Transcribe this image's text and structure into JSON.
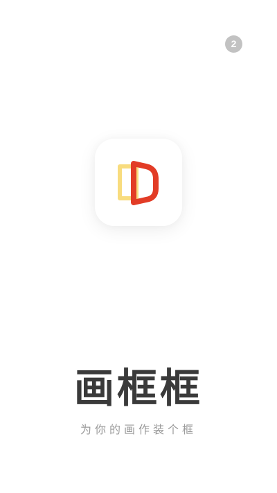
{
  "skip_badge": {
    "count": "2"
  },
  "app_icon": {
    "name": "frame-logo-icon",
    "colors": {
      "back_frame": "#f8dc7e",
      "front_frame": "#e23c26",
      "tile_background": "#ffffff"
    }
  },
  "brand": {
    "title": "画框框",
    "slogan": "为你的画作装个框",
    "title_color": "#3a3a3a",
    "slogan_color": "#9a9a9a"
  }
}
